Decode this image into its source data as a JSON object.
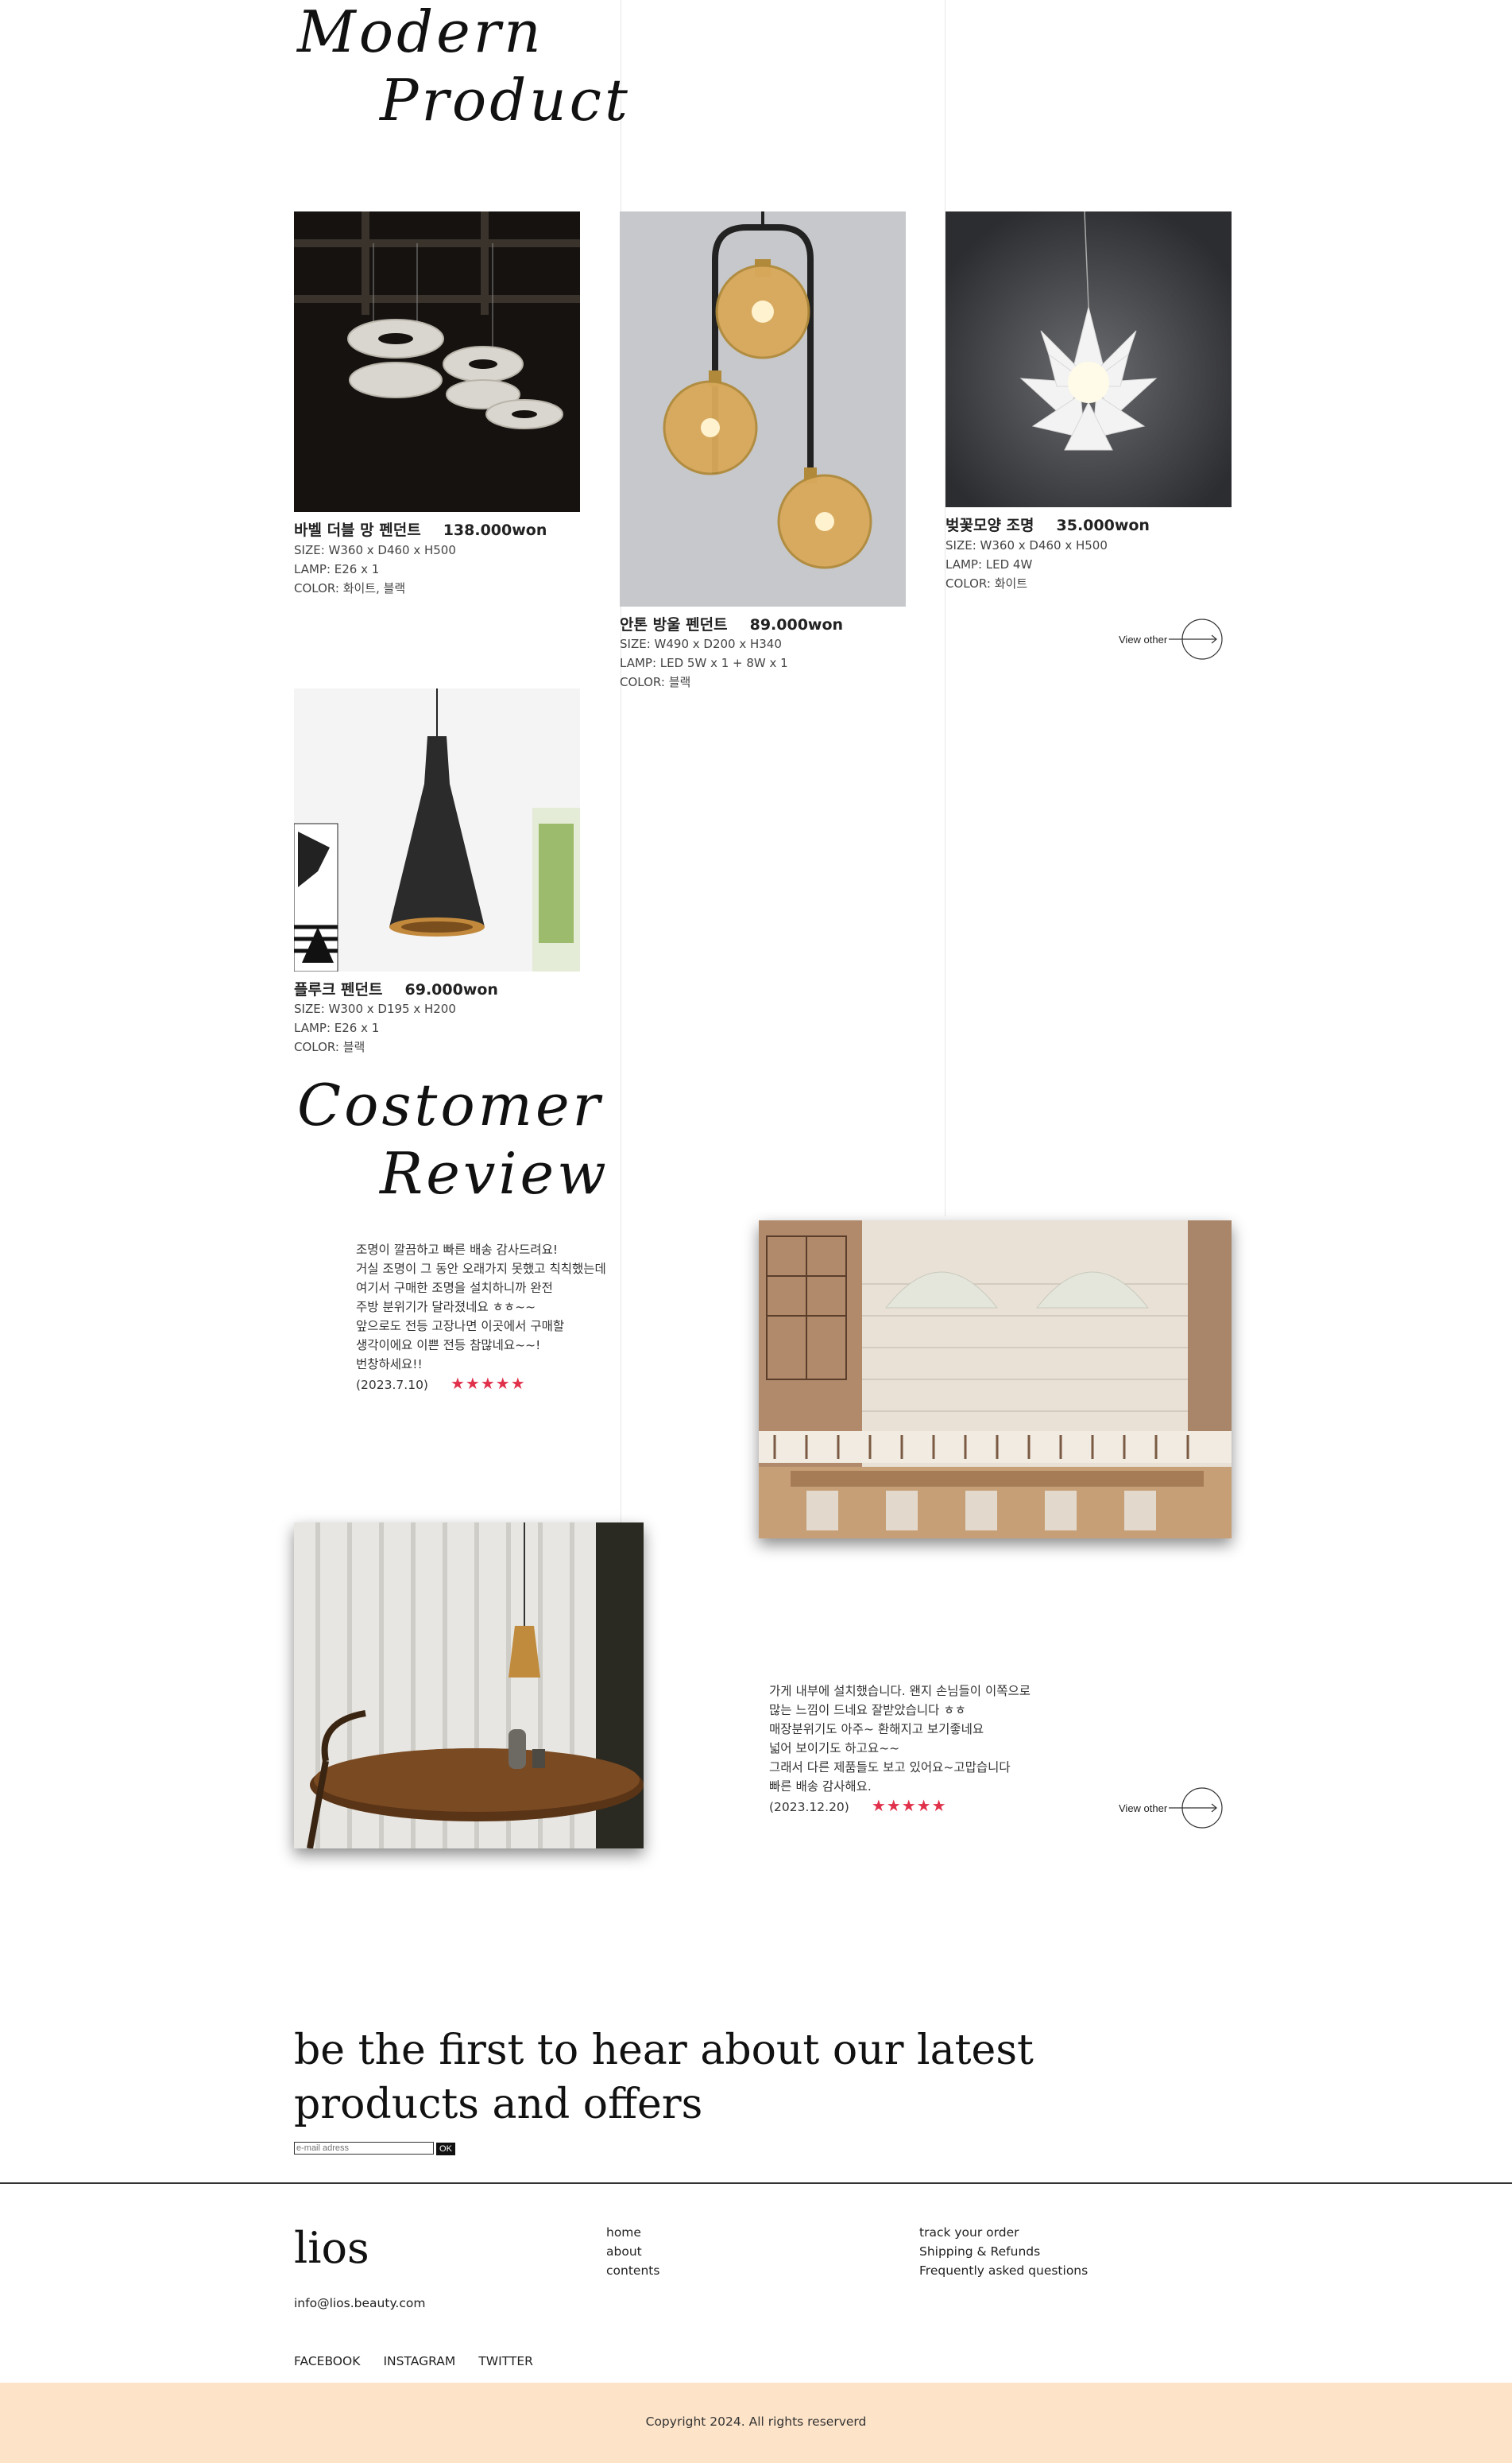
{
  "modern": {
    "line1": "Modern",
    "line2": "Product"
  },
  "products": [
    {
      "name": "바벨 더블 망 펜던트",
      "price": "138.000won",
      "size": "SIZE: W360 x D460 x H500",
      "lamp": "LAMP: E26 x 1",
      "color": "COLOR: 화이트, 블랙"
    },
    {
      "name": "안톤 방울 펜던트",
      "price": "89.000won",
      "size": "SIZE: W490 x D200 x H340",
      "lamp": "LAMP: LED 5W x 1 + 8W x 1",
      "color": "COLOR: 블랙"
    },
    {
      "name": "벚꽃모양 조명",
      "price": "35.000won",
      "size": "SIZE: W360 x D460 x H500",
      "lamp": "LAMP: LED 4W",
      "color": "COLOR: 화이트"
    },
    {
      "name": "플루크 펜던트",
      "price": "69.000won",
      "size": "SIZE: W300 x D195 x H200",
      "lamp": "LAMP: E26 x 1",
      "color": "COLOR: 블랙"
    }
  ],
  "view_other": "View other",
  "review_heading": {
    "line1": "Costomer",
    "line2": "Review"
  },
  "reviews": [
    {
      "lines": [
        "조명이 깔끔하고 빠른 배송 감사드려요!",
        "거실 조명이 그 동안 오래가지 못했고 칙칙했는데",
        "여기서 구매한 조명을 설치하니까 완전",
        "주방 분위기가 달라졌네요 ㅎㅎ~~",
        "앞으로도 전등 고장나면 이곳에서 구매할",
        "생각이에요 이쁜 전등 참많네요~~!",
        "번창하세요!!"
      ],
      "date": "(2023.7.10)",
      "stars": "★★★★★"
    },
    {
      "lines": [
        "가게 내부에 설치했습니다. 왠지 손님들이 이쪽으로",
        "많는 느낌이 드네요 잘받았습니다 ㅎㅎ",
        "매장분위기도 아주~ 환해지고 보기좋네요",
        "넓어 보이기도 하고요~~",
        "그래서 다른 제품들도 보고 있어요~고맙습니다",
        "빠른 배송 감사해요."
      ],
      "date": "(2023.12.20)",
      "stars": "★★★★★"
    }
  ],
  "newsletter": {
    "line1": "be the first to hear about our latest",
    "line2": "products and offers",
    "placeholder": "e-mail adress",
    "ok": "OK"
  },
  "footer": {
    "logo": "lios",
    "email": "info@lios.beauty.com",
    "nav1": [
      "home",
      "about",
      "contents"
    ],
    "nav2": [
      "track your order",
      "Shipping & Refunds",
      "Frequently asked questions"
    ],
    "social": [
      "FACEBOOK",
      "INSTAGRAM",
      "TWITTER"
    ],
    "copyright": "Copyright 2024. All rights reserverd"
  },
  "colors": {
    "star": "#e0304a",
    "footer_band": "#fde3c8"
  }
}
